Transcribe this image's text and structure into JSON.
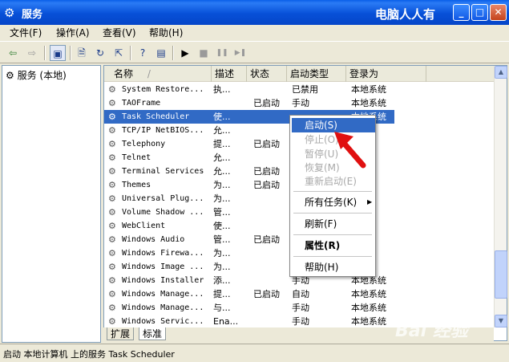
{
  "window": {
    "title": "服务",
    "title_watermark": "电脑人人有",
    "buttons": {
      "minimize": "_",
      "maximize": "□",
      "close": "✕"
    }
  },
  "menu": [
    "文件(F)",
    "操作(A)",
    "查看(V)",
    "帮助(H)"
  ],
  "toolbar": {
    "back": "⇦",
    "forward": "⇨",
    "tree": "▣",
    "properties": "🗎",
    "refresh": "↻",
    "export": "⇱",
    "help": "?",
    "console": "▤",
    "play": "▶",
    "stop": "■",
    "pause": "❚❚",
    "restart": "▶❚"
  },
  "tree": {
    "root": "服务 (本地)"
  },
  "columns": [
    "名称",
    "描述",
    "状态",
    "启动类型",
    "登录为"
  ],
  "sort_indicator": "/",
  "rows": [
    {
      "name": "System Restore...",
      "desc": "执...",
      "status": "",
      "start": "已禁用",
      "logon": "本地系统"
    },
    {
      "name": "TAOFrame",
      "desc": "",
      "status": "已启动",
      "start": "手动",
      "logon": "本地系统"
    },
    {
      "name": "Task Scheduler",
      "desc": "使...",
      "status": "",
      "start": "",
      "logon": "本地系统",
      "selected": true
    },
    {
      "name": "TCP/IP NetBIOS...",
      "desc": "允...",
      "status": "",
      "start": "",
      "logon": "服务"
    },
    {
      "name": "Telephony",
      "desc": "提...",
      "status": "已启动",
      "start": "",
      "logon": "系统"
    },
    {
      "name": "Telnet",
      "desc": "允...",
      "status": "",
      "start": "",
      "logon": "系统"
    },
    {
      "name": "Terminal Services",
      "desc": "允...",
      "status": "已启动",
      "start": "",
      "logon": "系统"
    },
    {
      "name": "Themes",
      "desc": "为...",
      "status": "已启动",
      "start": "",
      "logon": "系统"
    },
    {
      "name": "Universal Plug...",
      "desc": "为...",
      "status": "",
      "start": "",
      "logon": "服务"
    },
    {
      "name": "Volume Shadow ...",
      "desc": "管...",
      "status": "",
      "start": "",
      "logon": "系统"
    },
    {
      "name": "WebClient",
      "desc": "使...",
      "status": "",
      "start": "",
      "logon": "服务"
    },
    {
      "name": "Windows Audio",
      "desc": "管...",
      "status": "已启动",
      "start": "",
      "logon": "系统"
    },
    {
      "name": "Windows Firewa...",
      "desc": "为...",
      "status": "",
      "start": "",
      "logon": "系统"
    },
    {
      "name": "Windows Image ...",
      "desc": "为...",
      "status": "",
      "start": "",
      "logon": "服务"
    },
    {
      "name": "Windows Installer",
      "desc": "添...",
      "status": "",
      "start": "手动",
      "logon": "本地系统"
    },
    {
      "name": "Windows Manage...",
      "desc": "提...",
      "status": "已启动",
      "start": "自动",
      "logon": "本地系统"
    },
    {
      "name": "Windows Manage...",
      "desc": "与...",
      "status": "",
      "start": "手动",
      "logon": "本地系统"
    },
    {
      "name": "Windows Servic...",
      "desc": "Ena...",
      "status": "",
      "start": "手动",
      "logon": "本地系统"
    }
  ],
  "context_menu": {
    "start": "启动(S)",
    "stop": "停止(O)",
    "pause": "暂停(U)",
    "resume": "恢复(M)",
    "restart": "重新启动(E)",
    "all_tasks": "所有任务(K)",
    "all_tasks_arrow": "▶",
    "refresh": "刷新(F)",
    "properties": "属性(R)",
    "help": "帮助(H)"
  },
  "tabs": {
    "extended": "扩展",
    "standard": "标准"
  },
  "status_bar": "启动 本地计算机 上的服务 Task Scheduler",
  "bottom_watermark": "Bai 经验",
  "icons": {
    "app": "gears-icon",
    "service": "gear-icon"
  },
  "colors": {
    "selection": "#316ac5",
    "titlebar": "#0a5fe8",
    "arrow": "#e01010"
  }
}
